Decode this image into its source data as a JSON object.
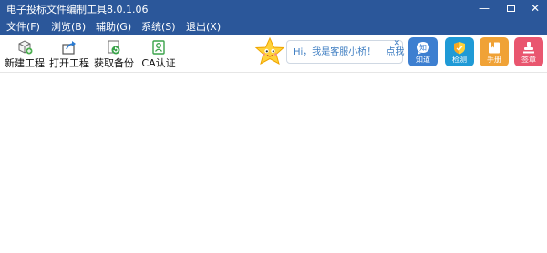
{
  "window": {
    "title": "电子投标文件编制工具8.0.1.06",
    "controls": {
      "minimize": "—",
      "close": "✕"
    }
  },
  "menu": [
    {
      "label": "文件(F)"
    },
    {
      "label": "浏览(B)"
    },
    {
      "label": "辅助(G)"
    },
    {
      "label": "系统(S)"
    },
    {
      "label": "退出(X)"
    }
  ],
  "toolbar": [
    {
      "label": "新建工程",
      "icon": "new-project-icon"
    },
    {
      "label": "打开工程",
      "icon": "open-project-icon"
    },
    {
      "label": "获取备份",
      "icon": "get-backup-icon"
    },
    {
      "label": "CA认证",
      "icon": "ca-cert-icon"
    }
  ],
  "assistant": {
    "greeting": "Hi，我是客服小桥！",
    "link": "点我",
    "close": "✕",
    "mascot_icon": "star-mascot-icon"
  },
  "quick_buttons": [
    {
      "label": "知道",
      "icon": "know-icon",
      "color": "#3d7fd0"
    },
    {
      "label": "检测",
      "icon": "shield-check-icon",
      "color": "#1f9ad6"
    },
    {
      "label": "手册",
      "icon": "manual-icon",
      "color": "#f0a236"
    },
    {
      "label": "签章",
      "icon": "stamp-icon",
      "color": "#e9566f"
    }
  ],
  "colors": {
    "titlebar": "#2b579a",
    "link": "#3f7ec2"
  }
}
